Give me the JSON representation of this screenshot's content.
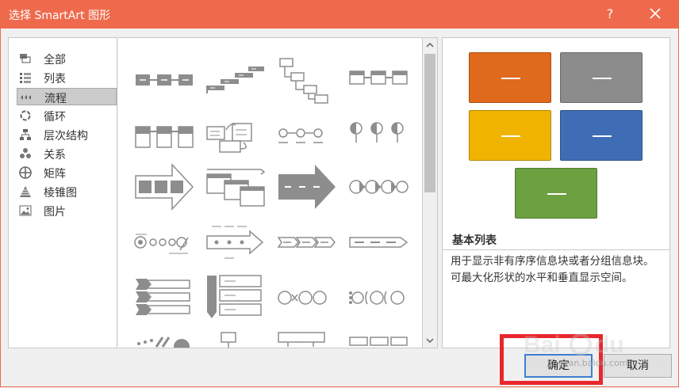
{
  "dialog": {
    "title": "选择 SmartArt 图形",
    "help_label": "?",
    "ok_label": "确定",
    "cancel_label": "取消"
  },
  "categories": [
    {
      "label": "全部",
      "icon": "all-icon"
    },
    {
      "label": "列表",
      "icon": "list-icon"
    },
    {
      "label": "流程",
      "icon": "process-icon",
      "selected": true
    },
    {
      "label": "循环",
      "icon": "cycle-icon"
    },
    {
      "label": "层次结构",
      "icon": "hierarchy-icon"
    },
    {
      "label": "关系",
      "icon": "relationship-icon"
    },
    {
      "label": "矩阵",
      "icon": "matrix-icon"
    },
    {
      "label": "棱锥图",
      "icon": "pyramid-icon"
    },
    {
      "label": "图片",
      "icon": "picture-icon"
    }
  ],
  "preview": {
    "title": "基本列表",
    "description": "用于显示非有序序信息块或者分组信息块。可最大化形状的水平和垂直显示空间。",
    "colors": [
      "#e06a1b",
      "#8c8c8c",
      "#f0b400",
      "#3e6db5",
      "#6ca040"
    ]
  },
  "watermark": {
    "text": "jingyan.baidu.com"
  }
}
